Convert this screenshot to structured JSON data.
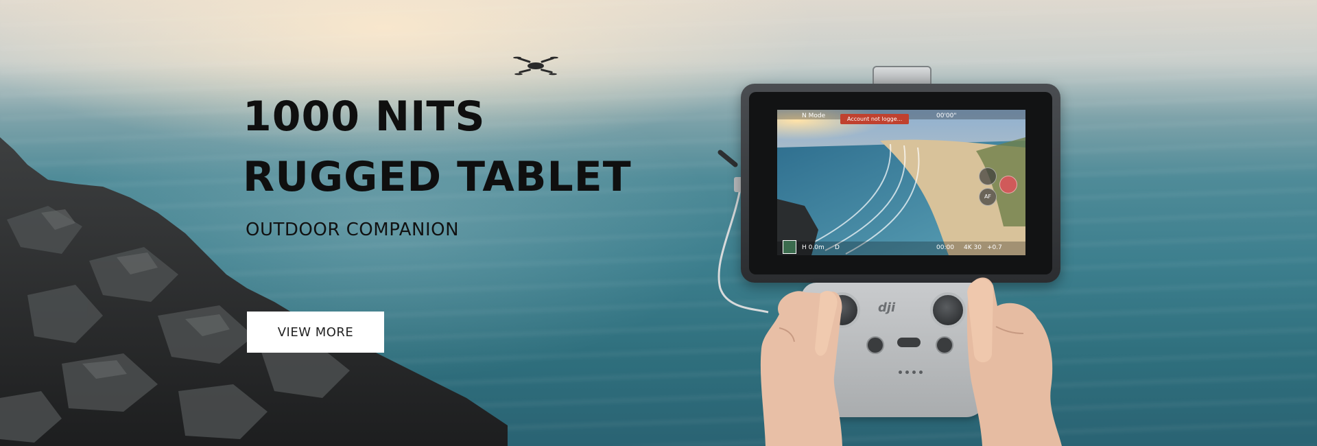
{
  "banner": {
    "headline": [
      "1000 NITS",
      "RUGGED TABLET"
    ],
    "subheadline": "OUTDOOR COMPANION",
    "cta_label": "VIEW MORE"
  },
  "tablet_screen": {
    "mode": "N Mode",
    "alert": "Account not logge...",
    "timer": "00'00\"",
    "height": "H 0.0m",
    "distance": "D",
    "record_time": "00:00",
    "resolution": "4K 30",
    "ev": "+0.7",
    "af_button": "AF"
  },
  "controller": {
    "brand": "dji"
  },
  "colors": {
    "headline": "#0f0f0f",
    "cta_background": "#ffffff",
    "alert_badge": "#c0412f"
  }
}
